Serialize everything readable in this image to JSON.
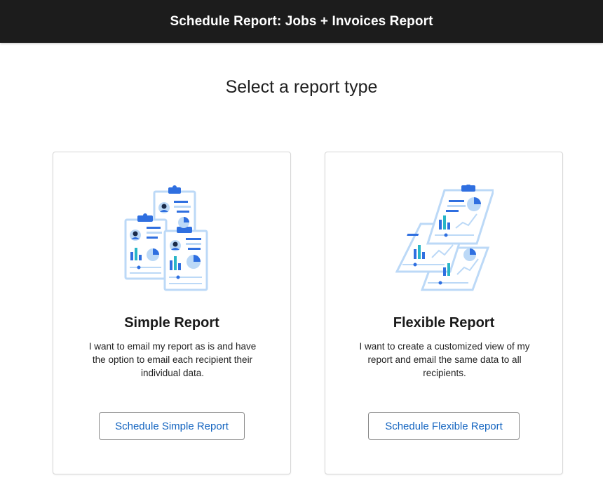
{
  "header": {
    "title": "Schedule Report: Jobs + Invoices Report"
  },
  "page": {
    "title": "Select a report type"
  },
  "cards": [
    {
      "id": "simple",
      "title": "Simple Report",
      "description": "I want to email my report as is and have the option to email each recipient their individual data.",
      "button_label": "Schedule Simple Report",
      "icon": "clipboard-reports-illustration"
    },
    {
      "id": "flexible",
      "title": "Flexible Report",
      "description": "I want to create a customized view of my report and email the same data to all recipients.",
      "button_label": "Schedule Flexible Report",
      "icon": "layered-reports-illustration"
    }
  ],
  "colors": {
    "header_bg": "#1c1c1c",
    "accent_blue": "#1565c0",
    "illus_blue": "#2f6fe0",
    "illus_light": "#bcd9f7",
    "illus_teal": "#28b5c7"
  }
}
